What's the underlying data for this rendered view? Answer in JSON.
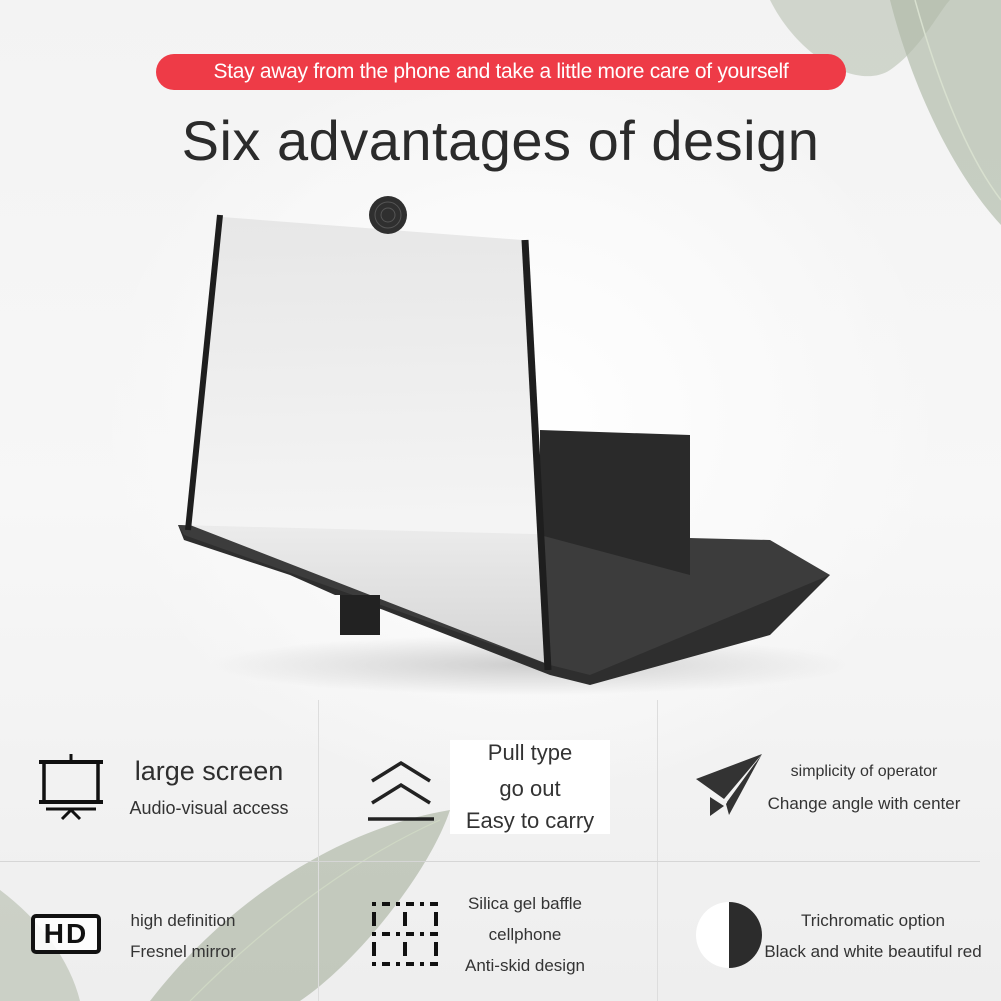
{
  "banner": {
    "text": "Stay away from the phone and take a little more care of yourself",
    "color": "#ee3b47"
  },
  "title": "Six advantages of design",
  "features": [
    {
      "icon": "projector-screen-icon",
      "lines": [
        "large screen",
        "Audio-visual access"
      ]
    },
    {
      "icon": "double-chevron-up-icon",
      "lines": [
        "Pull type",
        "go out",
        "Easy to carry"
      ]
    },
    {
      "icon": "paper-plane-icon",
      "lines": [
        "simplicity of operator",
        "Change angle with center"
      ]
    },
    {
      "icon": "hd-badge-icon",
      "icon_text": "HD",
      "lines": [
        "high definition",
        "Fresnel mirror"
      ]
    },
    {
      "icon": "dashed-grid-icon",
      "lines": [
        "Silica gel baffle",
        "cellphone",
        "Anti-skid design"
      ]
    },
    {
      "icon": "half-circle-icon",
      "lines": [
        "Trichromatic option",
        "Black and white beautiful red"
      ]
    }
  ]
}
